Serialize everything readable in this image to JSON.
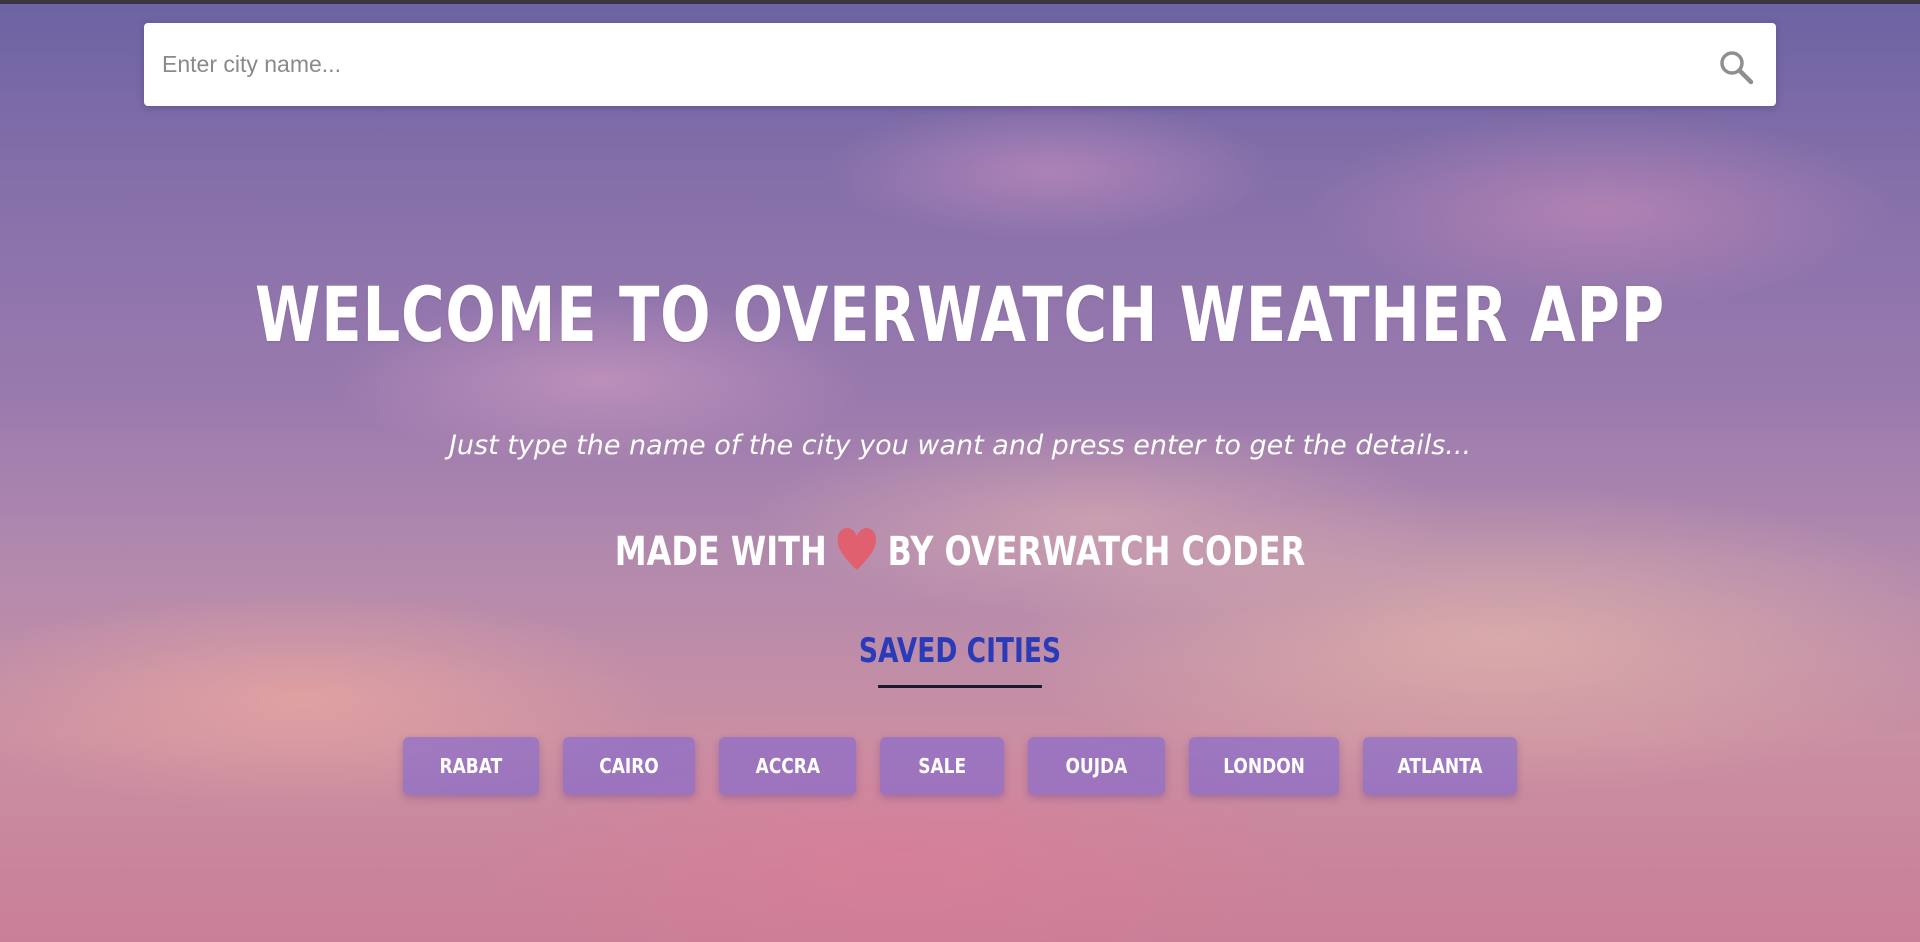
{
  "search": {
    "placeholder": "Enter city name...",
    "value": ""
  },
  "hero": {
    "title": "WELCOME TO OVERWATCH WEATHER APP",
    "subtitle": "Just type the name of the city you want and press enter to get the details...",
    "made_with_prefix": "MADE WITH",
    "made_with_suffix": "BY OVERWATCH CODER"
  },
  "saved": {
    "title": "SAVED CITIES",
    "cities": [
      "RABAT",
      "CAIRO",
      "ACCRA",
      "SALE",
      "OUJDA",
      "LONDON",
      "ATLANTA"
    ]
  },
  "icons": {
    "search": "search-icon",
    "heart": "heart-icon"
  },
  "colors": {
    "heart": "#e06070",
    "saved_title": "#2a3bb8",
    "city_button": "#8068d0"
  }
}
